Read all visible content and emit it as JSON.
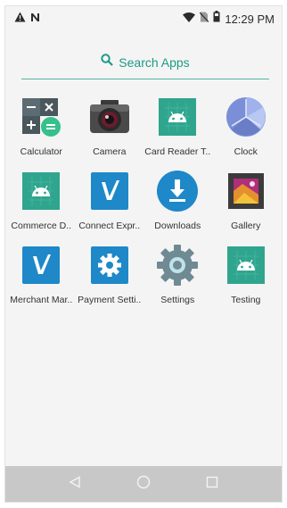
{
  "status_bar": {
    "time": "12:29 PM",
    "icons": [
      "alert-triangle-icon",
      "n-icon",
      "wifi-icon",
      "no-sim-icon",
      "battery-icon"
    ]
  },
  "search": {
    "label": "Search Apps"
  },
  "apps": [
    {
      "label": "Calculator"
    },
    {
      "label": "Camera"
    },
    {
      "label": "Card Reader T.."
    },
    {
      "label": "Clock"
    },
    {
      "label": "Commerce D.."
    },
    {
      "label": "Connect Expr.."
    },
    {
      "label": "Downloads"
    },
    {
      "label": "Gallery"
    },
    {
      "label": "Merchant Mar.."
    },
    {
      "label": "Payment Setti.."
    },
    {
      "label": "Settings"
    },
    {
      "label": "Testing"
    }
  ],
  "nav_bar": {
    "icons": [
      "back-icon",
      "home-icon",
      "recents-icon"
    ]
  },
  "colors": {
    "accent": "#1d9a86",
    "android_green": "#2fa58e",
    "blue": "#1e88c8",
    "navbar": "#c8c8c8"
  }
}
